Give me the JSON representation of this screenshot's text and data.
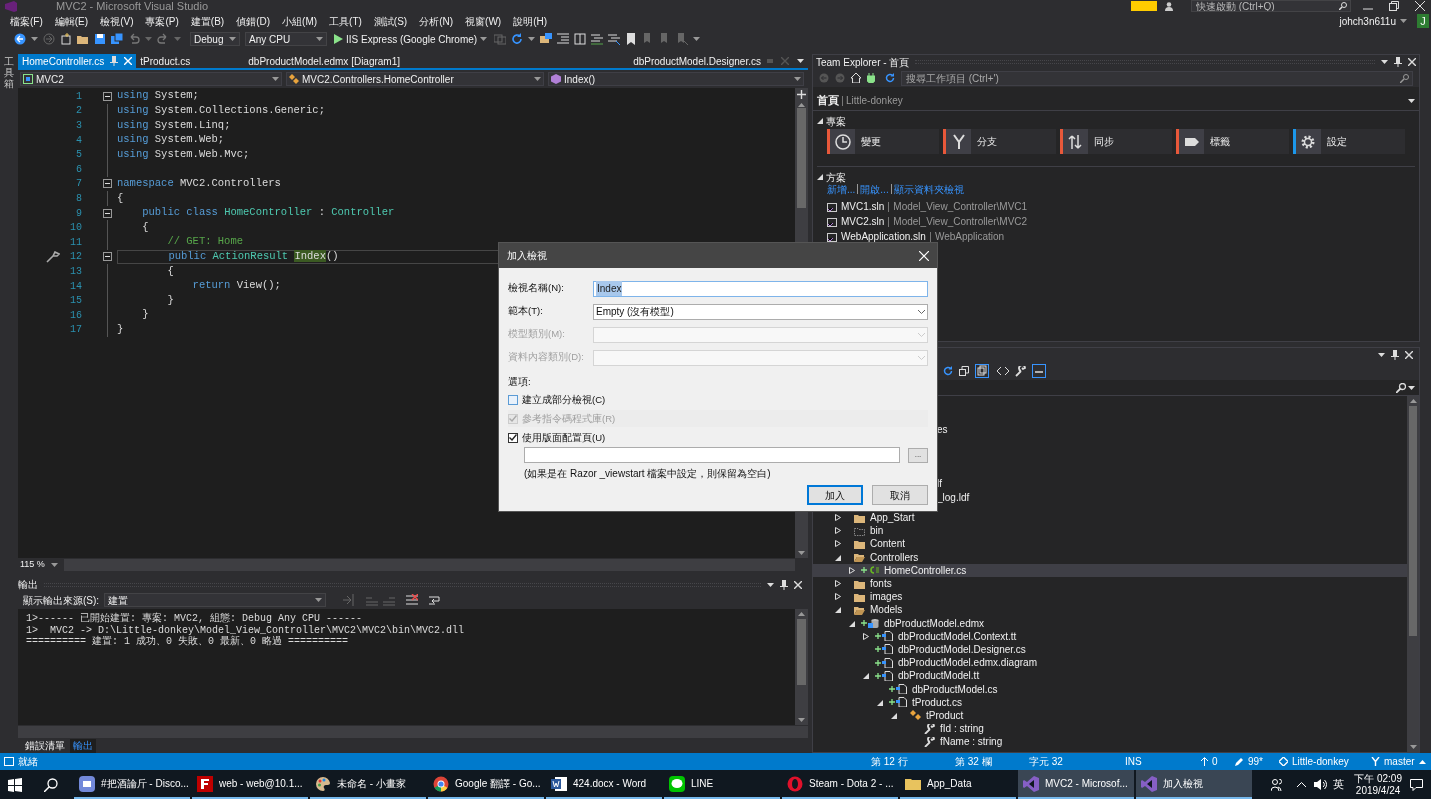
{
  "window": {
    "title": "MVC2 - Microsoft Visual Studio",
    "quick_launch": {
      "placeholder": "快速啟動 (Ctrl+Q)"
    },
    "user": "johch3n611u",
    "avatar": "J"
  },
  "menu": [
    "檔案(F)",
    "編輯(E)",
    "檢視(V)",
    "專案(P)",
    "建置(B)",
    "偵錯(D)",
    "小組(M)",
    "工具(T)",
    "測試(S)",
    "分析(N)",
    "視窗(W)",
    "說明(H)"
  ],
  "toolbar": {
    "configuration": "Debug",
    "platform": "Any CPU",
    "run": "IIS Express (Google Chrome)"
  },
  "toolbox_strip": "工具箱",
  "editor": {
    "tabs": [
      {
        "label": "HomeController.cs",
        "selected": true
      },
      {
        "label": "tProduct.cs",
        "selected": false
      },
      {
        "label": "dbProductModel.edmx [Diagram1]",
        "selected": false
      },
      {
        "label": "dbProductModel.Designer.cs",
        "selected": false
      }
    ],
    "nav": {
      "project": "MVC2",
      "type": "MVC2.Controllers.HomeController",
      "member": "Index()"
    },
    "lines": [
      {
        "number": "1",
        "fold": true,
        "current": false,
        "segments": [
          {
            "kind": "kw",
            "text": "using"
          },
          {
            "kind": "text",
            "text": " System;"
          }
        ]
      },
      {
        "number": "2",
        "fold": false,
        "current": false,
        "segments": [
          {
            "kind": "kw",
            "text": "using"
          },
          {
            "kind": "text",
            "text": " System.Collections.Generic;"
          }
        ]
      },
      {
        "number": "3",
        "fold": false,
        "current": false,
        "segments": [
          {
            "kind": "kw",
            "text": "using"
          },
          {
            "kind": "text",
            "text": " System.Linq;"
          }
        ]
      },
      {
        "number": "4",
        "fold": false,
        "current": false,
        "segments": [
          {
            "kind": "kw",
            "text": "using"
          },
          {
            "kind": "text",
            "text": " System.Web;"
          }
        ]
      },
      {
        "number": "5",
        "fold": false,
        "current": false,
        "segments": [
          {
            "kind": "kw",
            "text": "using"
          },
          {
            "kind": "text",
            "text": " System.Web.Mvc;"
          }
        ]
      },
      {
        "number": "6",
        "fold": false,
        "current": false
      },
      {
        "number": "7",
        "fold": true,
        "current": false,
        "segments": [
          {
            "kind": "kw",
            "text": "namespace"
          },
          {
            "kind": "text",
            "text": " MVC2.Controllers"
          }
        ]
      },
      {
        "number": "8",
        "fold": false,
        "current": false,
        "segments": [
          {
            "kind": "text",
            "text": "{"
          }
        ]
      },
      {
        "number": "9",
        "fold": true,
        "current": false,
        "segments": [
          {
            "kind": "kw",
            "text": "    public class"
          },
          {
            "kind": "type",
            "text": " HomeController"
          },
          {
            "kind": "text",
            "text": " : "
          },
          {
            "kind": "type",
            "text": "Controller"
          }
        ]
      },
      {
        "number": "10",
        "fold": false,
        "current": false,
        "segments": [
          {
            "kind": "text",
            "text": "    {"
          }
        ]
      },
      {
        "number": "11",
        "fold": false,
        "current": false,
        "segments": [
          {
            "kind": "comment",
            "text": "        // GET: Home"
          }
        ]
      },
      {
        "number": "12",
        "fold": true,
        "current": true,
        "segments": [
          {
            "kind": "kw",
            "text": "        public"
          },
          {
            "kind": "type",
            "text": " ActionResult "
          },
          {
            "kind": "ref",
            "text": "Index"
          },
          {
            "kind": "text",
            "text": "()"
          }
        ]
      },
      {
        "number": "13",
        "fold": false,
        "current": false,
        "segments": [
          {
            "kind": "text",
            "text": "        {"
          }
        ]
      },
      {
        "number": "14",
        "fold": false,
        "current": false,
        "segments": [
          {
            "kind": "kw",
            "text": "            return"
          },
          {
            "kind": "text",
            "text": " View();"
          }
        ]
      },
      {
        "number": "15",
        "fold": false,
        "current": false,
        "segments": [
          {
            "kind": "text",
            "text": "        }"
          }
        ]
      },
      {
        "number": "16",
        "fold": false,
        "current": false,
        "segments": [
          {
            "kind": "text",
            "text": "    }"
          }
        ]
      },
      {
        "number": "17",
        "fold": false,
        "current": false,
        "segments": [
          {
            "kind": "text",
            "text": "}"
          }
        ]
      }
    ],
    "zoom": "115 %"
  },
  "output": {
    "title": "輸出",
    "source_label": "顯示輸出來源(S):",
    "source": "建置",
    "lines": [
      "1>------ 已開始建置: 專案: MVC2, 組態: Debug Any CPU ------",
      "1>  MVC2 -> D:\\Little-donkey\\Model_View_Controller\\MVC2\\MVC2\\bin\\MVC2.dll",
      "========== 建置: 1 成功、0 失敗、0 最新、0 略過 =========="
    ]
  },
  "bottom_tabs": [
    {
      "label": "錯誤清單",
      "selected": false
    },
    {
      "label": "輸出",
      "selected": true
    }
  ],
  "team_explorer": {
    "title": "Team Explorer - 首頁",
    "search": {
      "placeholder": "搜尋工作項目 (Ctrl+')"
    },
    "page": "首頁",
    "repository": "Little-donkey",
    "project_section": {
      "title": "專案",
      "expanded": true,
      "tiles": [
        {
          "label": "變更",
          "kind": "clock",
          "color": "#e8583a"
        },
        {
          "label": "分支",
          "kind": "branch",
          "color": "#e8583a"
        },
        {
          "label": "同步",
          "kind": "sync",
          "color": "#e8583a"
        },
        {
          "label": "標籤",
          "kind": "tag",
          "color": "#e8583a"
        },
        {
          "label": "設定",
          "kind": "gear",
          "color": "#1c97ea"
        }
      ]
    },
    "solution_section": {
      "title": "方案",
      "expanded": true,
      "links": [
        "新增...",
        "開啟...",
        "顯示資料夾檢視"
      ],
      "solutions": [
        {
          "name": "MVC1.sln",
          "path": "Model_View_Controller\\MVC1"
        },
        {
          "name": "MVC2.sln",
          "path": "Model_View_Controller\\MVC2"
        },
        {
          "name": "WebApplication.sln",
          "path": "WebApplication"
        }
      ]
    }
  },
  "solution_explorer": {
    "fragments": [
      "es",
      "lf",
      "_log.ldf"
    ],
    "tree": [
      {
        "label": "App_Start",
        "kind": "folder",
        "expanded": false,
        "added": false,
        "selected": false
      },
      {
        "label": "bin",
        "kind": "hidden-folder",
        "expanded": false,
        "added": false,
        "selected": false
      },
      {
        "label": "Content",
        "kind": "folder",
        "expanded": false,
        "added": false,
        "selected": false
      },
      {
        "label": "Controllers",
        "kind": "folder",
        "expanded": true,
        "added": false,
        "selected": false,
        "children": [
          {
            "label": "HomeController.cs",
            "kind": "cs",
            "expanded": false,
            "added": true,
            "selected": true
          }
        ]
      },
      {
        "label": "fonts",
        "kind": "folder",
        "expanded": false,
        "added": false,
        "selected": false
      },
      {
        "label": "images",
        "kind": "folder",
        "expanded": false,
        "added": false,
        "selected": false
      },
      {
        "label": "Models",
        "kind": "folder",
        "expanded": true,
        "added": false,
        "selected": false,
        "children": [
          {
            "label": "dbProductModel.edmx",
            "kind": "model",
            "expanded": true,
            "added": true,
            "selected": false,
            "children": [
              {
                "label": "dbProductModel.Context.tt",
                "kind": "file",
                "expanded": false,
                "added": true,
                "selected": false
              },
              {
                "label": "dbProductModel.Designer.cs",
                "kind": "file",
                "added": true,
                "selected": false
              },
              {
                "label": "dbProductModel.edmx.diagram",
                "kind": "file",
                "added": true,
                "selected": false
              },
              {
                "label": "dbProductModel.tt",
                "kind": "file",
                "expanded": true,
                "added": true,
                "selected": false,
                "children": [
                  {
                    "label": "dbProductModel.cs",
                    "kind": "file",
                    "added": true,
                    "selected": false
                  },
                  {
                    "label": "tProduct.cs",
                    "kind": "file",
                    "expanded": true,
                    "added": true,
                    "selected": false,
                    "children": [
                      {
                        "label": "tProduct",
                        "kind": "class",
                        "expanded": true,
                        "added": false,
                        "selected": false,
                        "children": [
                          {
                            "label": "fId : string",
                            "kind": "property",
                            "added": false,
                            "selected": false
                          },
                          {
                            "label": "fName : string",
                            "kind": "property",
                            "added": false,
                            "selected": false
                          }
                        ]
                      }
                    ]
                  }
                ]
              }
            ]
          }
        ]
      }
    ]
  },
  "dialog": {
    "title": "加入檢視",
    "fields": [
      {
        "label": "檢視名稱(N):",
        "kind": "text",
        "value": "Index",
        "value_selected": true,
        "disabled": false
      },
      {
        "label": "範本(T):",
        "kind": "select",
        "value": "Empty (沒有模型)",
        "disabled": false
      },
      {
        "label": "模型類別(M):",
        "kind": "select",
        "disabled": true
      },
      {
        "label": "資料內容類別(D):",
        "kind": "select",
        "disabled": true
      }
    ],
    "options_label": "選項:",
    "options": [
      {
        "label": "建立成部分檢視(C)",
        "checked": false,
        "disabled": false
      },
      {
        "label": "參考指令碼程式庫(R)",
        "checked": true,
        "disabled": true
      },
      {
        "label": "使用版面配置頁(U)",
        "checked": true,
        "disabled": false
      }
    ],
    "layout_hint": "(如果是在 Razor _viewstart 檔案中設定，則保留為空白)",
    "browse": "...",
    "buttons": [
      {
        "label": "加入",
        "default": true
      },
      {
        "label": "取消",
        "default": false
      }
    ]
  },
  "status_bar": {
    "message": "就緒",
    "line": "第 12 行",
    "column": "第 32 欄",
    "char": "字元 32",
    "mode": "INS",
    "pushes": "0",
    "changes": "99*",
    "repository": "Little-donkey",
    "branch": "master"
  },
  "taskbar": {
    "apps": [
      {
        "label": "#把酒論斤 - Disco...",
        "kind": "discord",
        "selected": false
      },
      {
        "label": "web - web@10.1...",
        "kind": "filezilla",
        "selected": false
      },
      {
        "label": "未命名 - 小畫家",
        "kind": "paint",
        "selected": false
      },
      {
        "label": "Google 翻譯 - Go...",
        "kind": "chrome",
        "selected": false
      },
      {
        "label": "424.docx - Word",
        "kind": "word",
        "selected": false
      },
      {
        "label": "LINE",
        "kind": "line",
        "selected": false
      },
      {
        "label": "Steam - Dota 2 - ...",
        "kind": "opera",
        "selected": false
      },
      {
        "label": "App_Data",
        "kind": "folder",
        "selected": false
      },
      {
        "label": "MVC2 - Microsof...",
        "kind": "vs",
        "selected": true
      },
      {
        "label": "加入檢視",
        "kind": "vs",
        "selected": true
      }
    ],
    "ime": "英",
    "time": "下午 02:09",
    "date": "2019/4/24"
  }
}
